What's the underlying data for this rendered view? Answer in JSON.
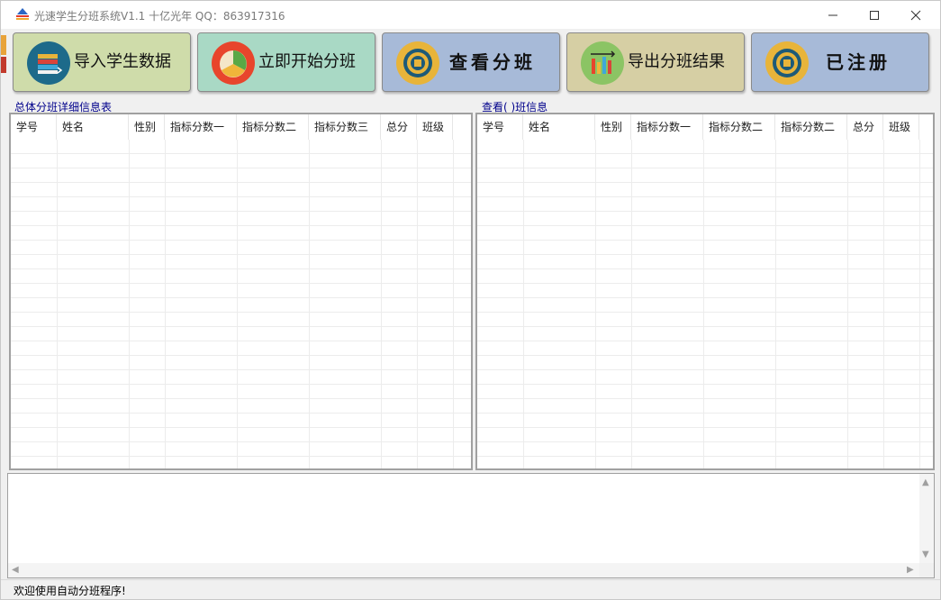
{
  "window": {
    "title": "光速学生分班系统V1.1 十亿光年 QQ：863917316"
  },
  "toolbar": {
    "buttons": [
      {
        "label": "导入学生数据",
        "icon": "books-icon",
        "bg": "#cfdcaa"
      },
      {
        "label": "立即开始分班",
        "icon": "pie-chart-icon",
        "bg": "#a9d9c5"
      },
      {
        "label": "查看分班",
        "icon": "target-icon",
        "bg": "#a7bad8"
      },
      {
        "label": "导出分班结果",
        "icon": "bar-chart-icon",
        "bg": "#d6cfa4"
      },
      {
        "label": "已注册",
        "icon": "target-icon",
        "bg": "#a7bad8"
      }
    ]
  },
  "left_panel": {
    "title": "总体分班详细信息表",
    "columns": [
      "学号",
      "姓名",
      "性别",
      "指标分数一",
      "指标分数二",
      "指标分数三",
      "总分",
      "班级"
    ]
  },
  "right_panel": {
    "title": "查看( )班信息",
    "columns": [
      "学号",
      "姓名",
      "性别",
      "指标分数一",
      "指标分数二",
      "指标分数二",
      "总分",
      "班级"
    ]
  },
  "status": {
    "message": "欢迎使用自动分班程序!"
  },
  "colors": {
    "section_label": "#00008b",
    "title_text": "#7a7a7a"
  }
}
